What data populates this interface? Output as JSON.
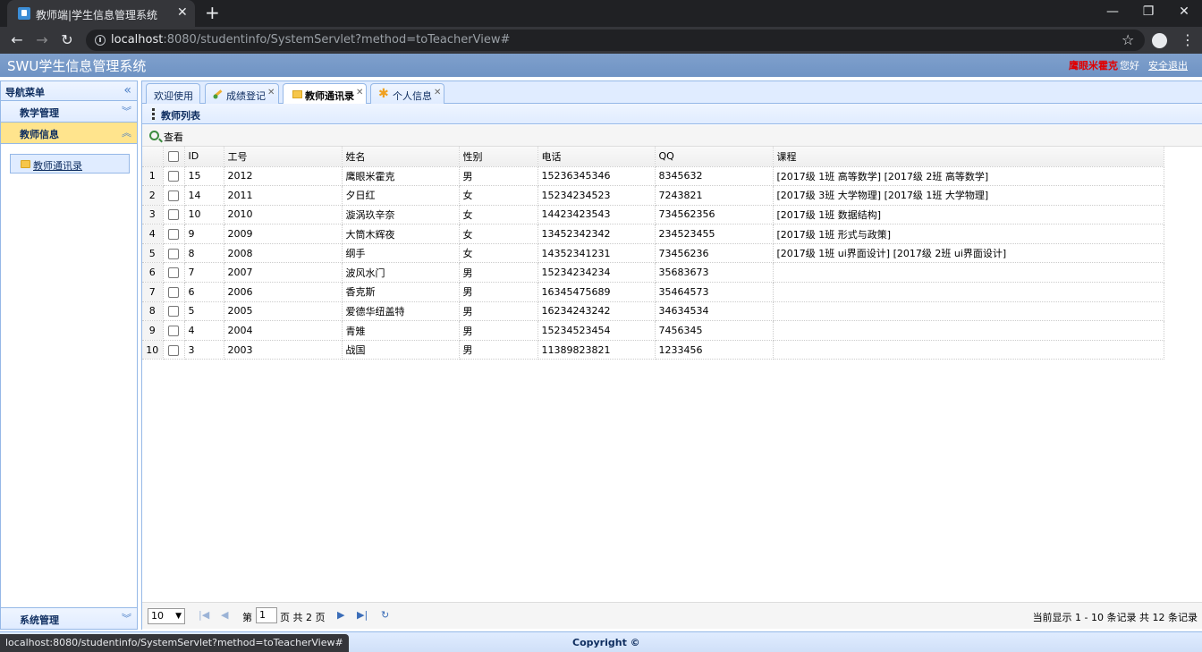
{
  "browser": {
    "tab_title": "教师端|学生信息管理系统",
    "url_host": "localhost",
    "url_rest": ":8080/studentinfo/SystemServlet?method=toTeacherView#",
    "status_url": "localhost:8080/studentinfo/SystemServlet?method=toTeacherView#"
  },
  "header": {
    "title": "SWU学生信息管理系统",
    "user_name": "鹰眼米霍克",
    "greeting": "您好",
    "logout": "安全退出"
  },
  "nav": {
    "title": "导航菜单",
    "panels": [
      {
        "label": "教学管理"
      },
      {
        "label": "教师信息"
      }
    ],
    "item": "教师通讯录",
    "bottom_panel": "系统管理"
  },
  "tabs": [
    {
      "label": "欢迎使用"
    },
    {
      "label": "成绩登记"
    },
    {
      "label": "教师通讯录"
    },
    {
      "label": "个人信息"
    }
  ],
  "list": {
    "title": "教师列表",
    "view_label": "查看",
    "columns": [
      "ID",
      "工号",
      "姓名",
      "性别",
      "电话",
      "QQ",
      "课程"
    ],
    "rows": [
      {
        "n": "1",
        "id": "15",
        "no": "2012",
        "name": "鹰眼米霍克",
        "sex": "男",
        "phone": "15236345346",
        "qq": "8345632",
        "course": "[2017级 1班 高等数学]   [2017级 2班 高等数学]"
      },
      {
        "n": "2",
        "id": "14",
        "no": "2011",
        "name": "夕日红",
        "sex": "女",
        "phone": "15234234523",
        "qq": "7243821",
        "course": "[2017级 3班 大学物理]   [2017级 1班 大学物理]"
      },
      {
        "n": "3",
        "id": "10",
        "no": "2010",
        "name": "漩涡玖辛奈",
        "sex": "女",
        "phone": "14423423543",
        "qq": "734562356",
        "course": "[2017级 1班 数据结构]"
      },
      {
        "n": "4",
        "id": "9",
        "no": "2009",
        "name": "大筒木辉夜",
        "sex": "女",
        "phone": "13452342342",
        "qq": "234523455",
        "course": "[2017级 1班 形式与政策]"
      },
      {
        "n": "5",
        "id": "8",
        "no": "2008",
        "name": "纲手",
        "sex": "女",
        "phone": "14352341231",
        "qq": "73456236",
        "course": "[2017级 1班 ui界面设计]   [2017级 2班 ui界面设计]"
      },
      {
        "n": "6",
        "id": "7",
        "no": "2007",
        "name": "波风水门",
        "sex": "男",
        "phone": "15234234234",
        "qq": "35683673",
        "course": ""
      },
      {
        "n": "7",
        "id": "6",
        "no": "2006",
        "name": "香克斯",
        "sex": "男",
        "phone": "16345475689",
        "qq": "35464573",
        "course": ""
      },
      {
        "n": "8",
        "id": "5",
        "no": "2005",
        "name": "爱德华纽盖特",
        "sex": "男",
        "phone": "16234243242",
        "qq": "34634534",
        "course": ""
      },
      {
        "n": "9",
        "id": "4",
        "no": "2004",
        "name": "青雉",
        "sex": "男",
        "phone": "15234523454",
        "qq": "7456345",
        "course": ""
      },
      {
        "n": "10",
        "id": "3",
        "no": "2003",
        "name": "战国",
        "sex": "男",
        "phone": "11389823821",
        "qq": "1233456",
        "course": ""
      }
    ]
  },
  "pager": {
    "page_size": "10",
    "page_prefix": "第",
    "page_value": "1",
    "page_suffix": "页 共 2 页",
    "info": "当前显示 1 - 10 条记录 共 12 条记录"
  },
  "footer": {
    "copyright": "Copyright ©"
  }
}
